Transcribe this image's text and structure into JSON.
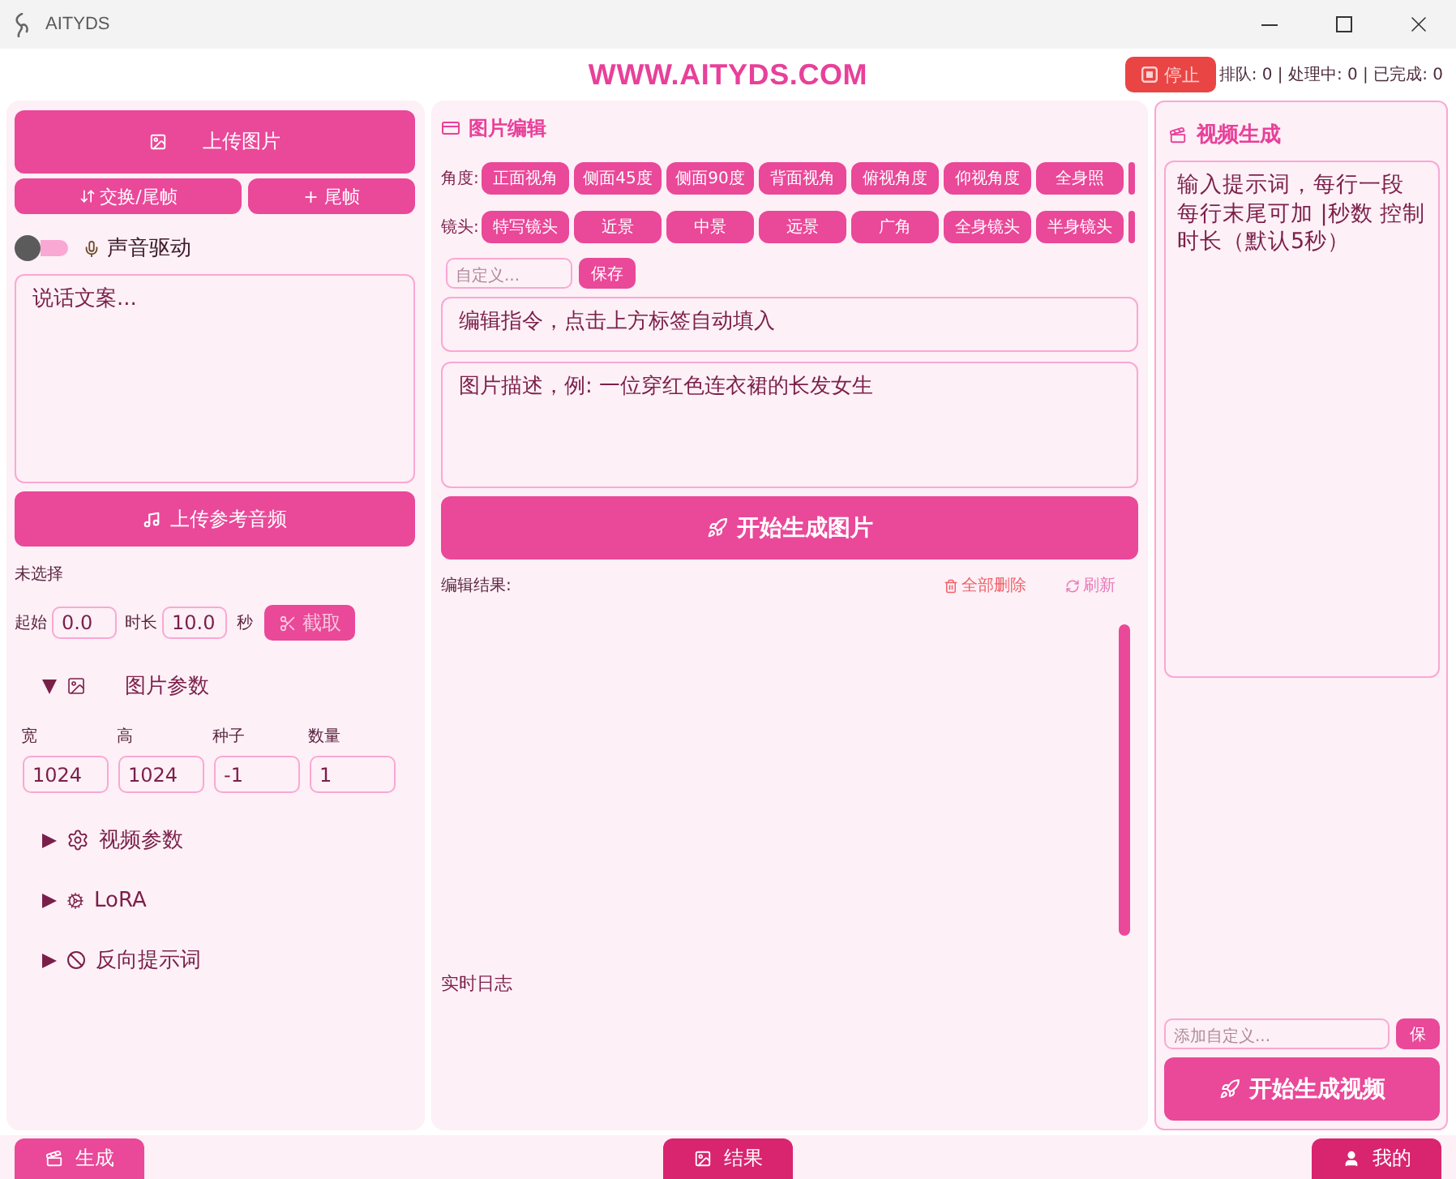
{
  "window": {
    "title": "AITYDS"
  },
  "header": {
    "site": "WWW.AITYDS.COM",
    "stop_button": "停止",
    "status": "排队: 0 | 处理中: 0 | 已完成: 0"
  },
  "left_panel": {
    "upload_image": "上传图片",
    "frame_buttons": [
      {
        "kind": "swap",
        "label": "交换/尾帧"
      },
      {
        "kind": "plain",
        "label": "+ 尾帧"
      }
    ],
    "voice_drive": {
      "label": "声音驱动",
      "on": false
    },
    "speech_text": {
      "placeholder": "说话文案..."
    },
    "upload_audio": "上传参考音频",
    "audio_file": "未选择",
    "clip": {
      "start_label": "起始",
      "start": "0.0",
      "duration_label": "时长",
      "duration": "10.0",
      "unit": "秒",
      "button": "截取"
    },
    "sections": [
      {
        "kind": "image",
        "title": "图片参数",
        "expanded": true,
        "fields": [
          {
            "label": "宽",
            "value": "1024"
          },
          {
            "label": "高",
            "value": "1024"
          },
          {
            "label": "种子",
            "value": "-1"
          },
          {
            "label": "数量",
            "value": "1"
          }
        ]
      },
      {
        "kind": "video",
        "title": "视频参数",
        "expanded": false
      },
      {
        "kind": "lora",
        "title": "LoRA",
        "expanded": false
      },
      {
        "kind": "negative",
        "title": "反向提示词",
        "expanded": false
      }
    ]
  },
  "image_edit": {
    "title": "图片编辑",
    "tag_rows": [
      {
        "label": "角度:",
        "tags": [
          "正面视角",
          "侧面45度",
          "侧面90度",
          "背面视角",
          "俯视角度",
          "仰视角度",
          "全身照"
        ]
      },
      {
        "label": "镜头:",
        "tags": [
          "特写镜头",
          "近景",
          "中景",
          "远景",
          "广角",
          "全身镜头",
          "半身镜头"
        ]
      }
    ],
    "custom": {
      "placeholder": "自定义...",
      "button": "保存"
    },
    "instruction": {
      "placeholder": "编辑指令，点击上方标签自动填入"
    },
    "description": {
      "placeholder": "图片描述，例: 一位穿红色连衣裙的长发女生"
    },
    "generate_button": "开始生成图片",
    "results": {
      "label": "编辑结果:",
      "actions": [
        {
          "kind": "delete",
          "label": "全部删除"
        },
        {
          "kind": "refresh",
          "label": "刷新"
        }
      ]
    },
    "log": {
      "label": "实时日志"
    }
  },
  "video_gen": {
    "title": "视频生成",
    "prompt": {
      "placeholder_lines": [
        "输入提示词，每行一段",
        "每行末尾可加 |秒数 控制时长（默认5秒）"
      ]
    },
    "custom": {
      "placeholder": "添加自定义...",
      "button": "保"
    },
    "generate_button": "开始生成视频"
  },
  "bottom_nav": [
    {
      "kind": "generate",
      "label": "生成",
      "selected": true
    },
    {
      "kind": "results",
      "label": "结果",
      "selected": false
    },
    {
      "kind": "mine",
      "label": "我的",
      "selected": false
    }
  ]
}
